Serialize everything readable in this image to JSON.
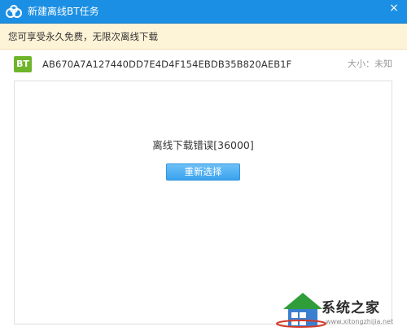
{
  "window": {
    "title": "新建离线BT任务",
    "close_symbol": "×"
  },
  "notice": {
    "text": "您可享受永久免费，无限次离线下载"
  },
  "file": {
    "badge": "BT",
    "hash": "AB670A7A127440DD7E4D4F154EBDB35B820AEB1F",
    "size_label": "大小：未知"
  },
  "status": {
    "error_message": "离线下载错误[36000]",
    "reselect_label": "重新选择"
  },
  "watermark": {
    "text": "系统之家",
    "url": "www.xitongzhijia.net"
  },
  "colors": {
    "titlebar": "#1b8fe4",
    "notice_bg": "#fdf3d6",
    "bt_badge": "#6fb52c",
    "button": "#3aa3ee"
  }
}
